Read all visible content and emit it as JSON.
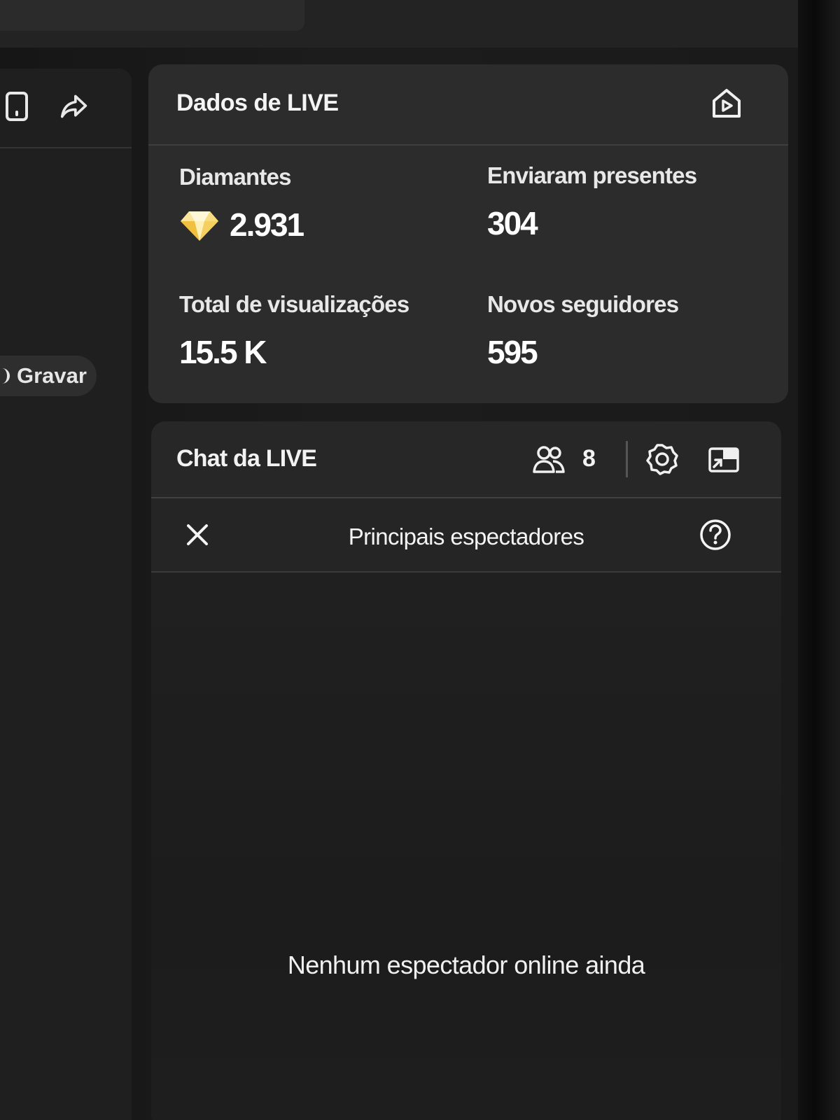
{
  "left_panel": {
    "record_label": "Gravar",
    "icons": [
      "phone-icon",
      "share-icon",
      "record-dot-icon"
    ]
  },
  "live_data": {
    "title": "Dados de LIVE",
    "header_icon": "live-home-icon",
    "stats": [
      {
        "label": "Diamantes",
        "value": "2.931",
        "icon": "diamond-icon"
      },
      {
        "label": "Enviaram presentes",
        "value": "304"
      },
      {
        "label": "Total de visualizações",
        "value": "15.5 K"
      },
      {
        "label": "Novos seguidores",
        "value": "595"
      }
    ],
    "accent_color": "#f5d060"
  },
  "chat": {
    "title": "Chat da LIVE",
    "viewer_count": "8",
    "icons": [
      "viewers-icon",
      "settings-icon",
      "popout-icon"
    ],
    "top_viewers": {
      "title": "Principais espectadores",
      "close_icon": "close-icon",
      "help_icon": "help-icon",
      "empty_message": "Nenhum espectador online ainda"
    }
  }
}
